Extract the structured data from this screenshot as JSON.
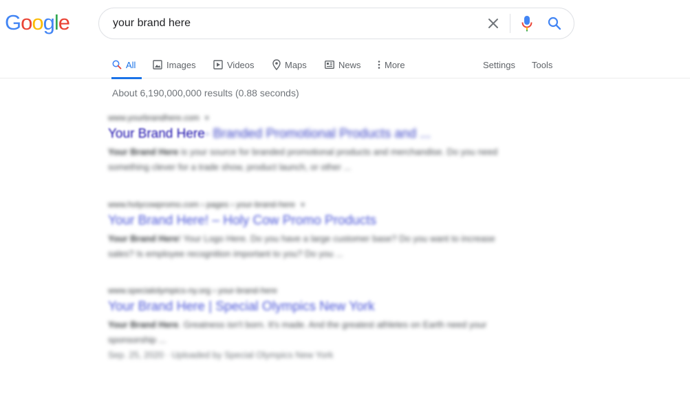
{
  "logo": {
    "letters": [
      "G",
      "o",
      "o",
      "g",
      "l",
      "e"
    ],
    "colors": [
      "#4285f4",
      "#ea4335",
      "#fbbc05",
      "#4285f4",
      "#34a853",
      "#ea4335"
    ]
  },
  "search": {
    "query": "your brand here",
    "clear_icon": "close-icon",
    "voice_icon": "microphone-icon",
    "search_icon": "search-icon"
  },
  "tabs": [
    {
      "label": "All",
      "icon": "search-icon",
      "active": true
    },
    {
      "label": "Images",
      "icon": "image-icon"
    },
    {
      "label": "Videos",
      "icon": "video-icon"
    },
    {
      "label": "Maps",
      "icon": "map-pin-icon"
    },
    {
      "label": "News",
      "icon": "news-icon"
    },
    {
      "label": "More",
      "icon": "more-vert-icon"
    }
  ],
  "tools": {
    "settings": "Settings",
    "tools": "Tools"
  },
  "stats": "About 6,190,000,000 results (0.88 seconds)",
  "results": [
    {
      "url": "www.yourbrandhere.com",
      "title_main": "Your Brand Here",
      "title_rest": " - Branded Promotional Products and ...",
      "snippet_bold": "Your Brand Here",
      "snippet": " is your source for branded promotional products and merchandise. Do you need something clever for a trade show, product launch, or other ..."
    },
    {
      "url": "www.holycowpromo.com › pages › your-brand-here",
      "title": "Your Brand Here! – Holy Cow Promo Products",
      "snippet_bold": "Your Brand Here",
      "snippet": "! Your Logo Here. Do you have a large customer base? Do you want to increase sales? Is employee recognition important to you? Do you ..."
    },
    {
      "url": "www.specialolympics-ny.org › your-brand-here",
      "title": "Your Brand Here | Special Olympics New York",
      "snippet_bold": "Your Brand Here",
      "snippet": ". Greatness isn't born. It's made. And the greatest athletes on Earth need your sponsorship ...",
      "date": "Sep. 25, 2020 · Uploaded by Special Olympics New York"
    }
  ],
  "colors": {
    "accent": "#1a73e8",
    "link": "#1a0dab"
  }
}
